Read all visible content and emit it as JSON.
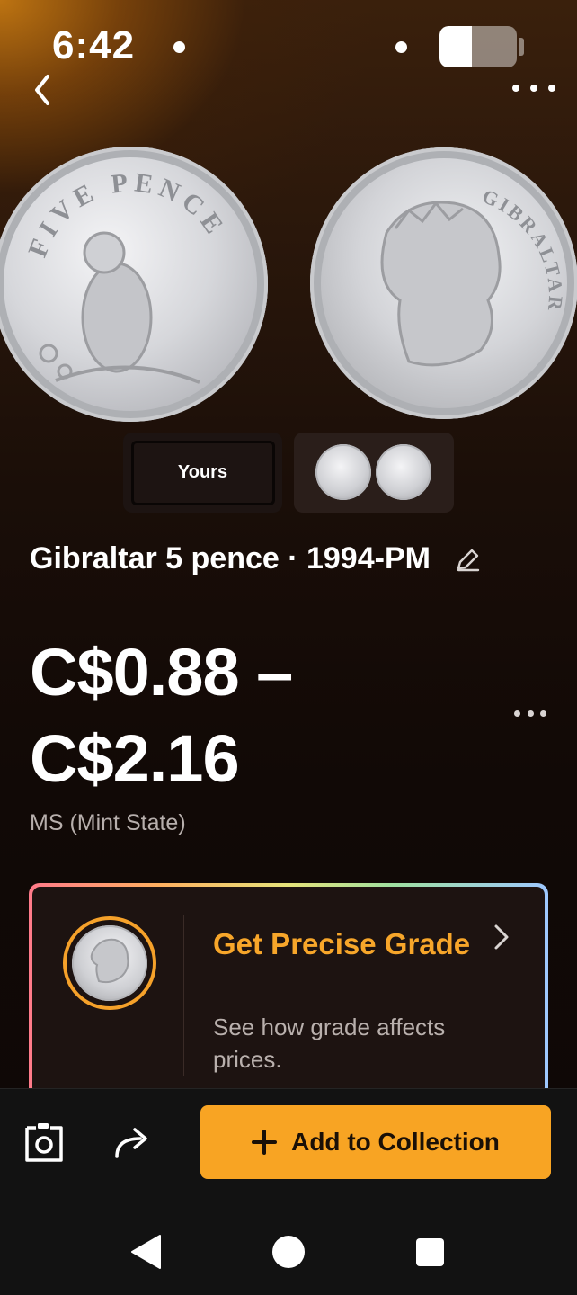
{
  "status_bar": {
    "time": "6:42",
    "battery_level": 0.42
  },
  "header": {
    "back_icon": "chevron-left-icon",
    "more_icon": "more-horizontal-icon"
  },
  "coin_images": {
    "reverse_inscription": "FIVE PENCE",
    "obverse_inscription": "GIBRALTAR"
  },
  "image_toggle": {
    "yours_label": "Yours",
    "reference_icon": "reference-coins-thumbnail"
  },
  "coin": {
    "title": "Gibraltar 5 pence · 1994-PM",
    "edit_icon": "pencil-icon"
  },
  "price": {
    "range_line1": "C$0.88 –",
    "range_line2": "C$2.16",
    "grade": "MS (Mint State)"
  },
  "grade_card": {
    "title": "Get Precise Grade",
    "subtitle": "See how grade affects prices.",
    "accent": "#f7a62a"
  },
  "bottom_actions": {
    "scan_icon": "camera-scan-icon",
    "share_icon": "share-arrow-icon",
    "add_label": "Add to Collection",
    "add_color": "#f8a423"
  },
  "nav": {
    "back": "nav-back-icon",
    "home": "nav-home-icon",
    "recents": "nav-recents-icon"
  }
}
